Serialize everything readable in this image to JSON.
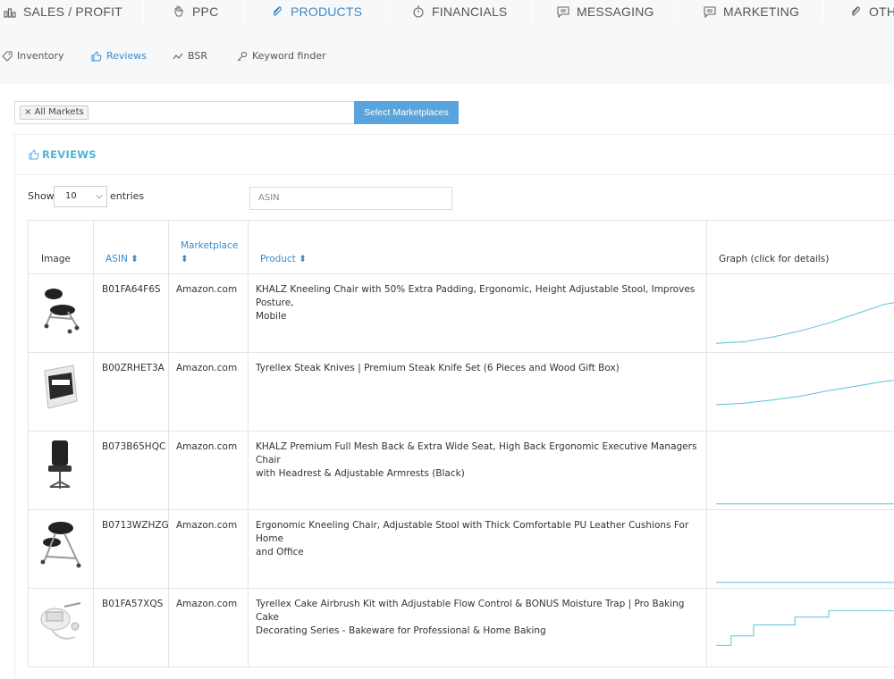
{
  "top_nav": [
    {
      "label": "SALES / PROFIT",
      "icon": "bar-chart-icon"
    },
    {
      "label": "PPC",
      "icon": "hand-icon"
    },
    {
      "label": "PRODUCTS",
      "icon": "paperclip-icon",
      "active": true
    },
    {
      "label": "FINANCIALS",
      "icon": "stopwatch-icon"
    },
    {
      "label": "MESSAGING",
      "icon": "chat-icon"
    },
    {
      "label": "MARKETING",
      "icon": "chat-icon"
    },
    {
      "label": "OTH",
      "icon": "paperclip-icon"
    }
  ],
  "sub_nav": [
    {
      "label": "Inventory",
      "icon": "tag-icon"
    },
    {
      "label": "Reviews",
      "icon": "thumbs-up-icon",
      "active": true
    },
    {
      "label": "BSR",
      "icon": "trend-icon"
    },
    {
      "label": "Keyword finder",
      "icon": "key-icon"
    }
  ],
  "markets": {
    "chip": "× All Markets",
    "button": "Select Marketplaces"
  },
  "panel": {
    "title": "REVIEWS"
  },
  "controls": {
    "show": "Show",
    "entries_value": "10",
    "entries": "entries",
    "search_placeholder": "ASIN"
  },
  "table": {
    "headers": {
      "image": "Image",
      "asin": "ASIN ⬍",
      "marketplace_1": "Marketplace",
      "marketplace_2": "⬍",
      "product": "Product ⬍",
      "graph": "Graph (click for details)"
    },
    "rows": [
      {
        "asin": "B01FA64F6S",
        "marketplace": "Amazon.com",
        "product_1": "KHALZ Kneeling Chair with 50% Extra Padding, Ergonomic, Height Adjustable Stool, Improves Posture,",
        "product_2": "Mobile",
        "thumb": "kneeling-chair"
      },
      {
        "asin": "B00ZRHET3A",
        "marketplace": "Amazon.com",
        "product_1": "Tyrellex Steak Knives | Premium Steak Knife Set (6 Pieces and Wood Gift Box)",
        "product_2": "",
        "thumb": "knife-box"
      },
      {
        "asin": "B073B65HQC",
        "marketplace": "Amazon.com",
        "product_1": "KHALZ Premium Full Mesh Back & Extra Wide Seat, High Back Ergonomic Executive Managers Chair",
        "product_2": "with Headrest & Adjustable Armrests (Black)",
        "thumb": "office-chair"
      },
      {
        "asin": "B0713WZHZG",
        "marketplace": "Amazon.com",
        "product_1": "Ergonomic Kneeling Chair, Adjustable Stool with Thick Comfortable PU Leather Cushions For Home",
        "product_2": "and Office",
        "thumb": "kneeling-chair-2"
      },
      {
        "asin": "B01FA57XQS",
        "marketplace": "Amazon.com",
        "product_1": "Tyrellex Cake Airbrush Kit with Adjustable Flow Control & BONUS Moisture Trap | Pro Baking Cake",
        "product_2": "Decorating Series - Bakeware for Professional & Home Baking",
        "thumb": "airbrush-kit"
      }
    ]
  },
  "colors": {
    "accent": "#3a8bc9",
    "button": "#5aa4dc",
    "title": "#4fb3d9",
    "spark": "#5bc0de"
  }
}
